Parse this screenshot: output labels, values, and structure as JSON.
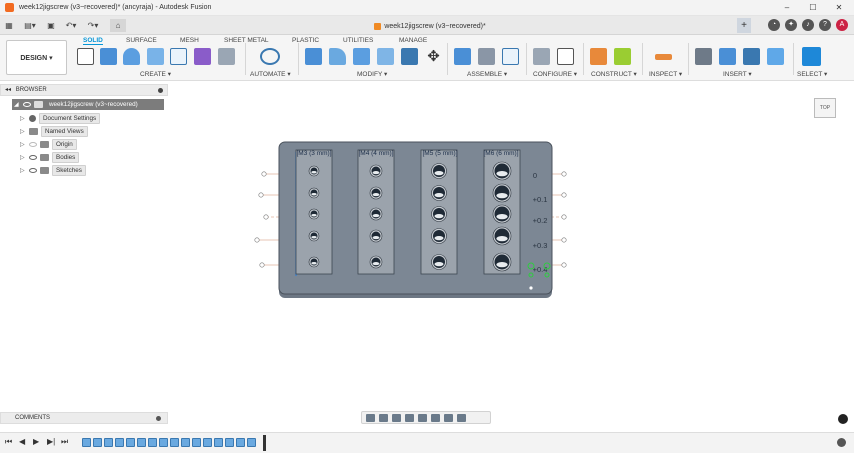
{
  "window": {
    "title": "week12jigscrew (v3~recovered)* (ancyraja) - Autodesk Fusion",
    "controls": [
      "–",
      "☐",
      "✕"
    ]
  },
  "tabstrip": {
    "document_tab": "week12jigscrew (v3~recovered)*"
  },
  "toolbar": {
    "workspace": "DESIGN ▾",
    "tabs": [
      "SOLID",
      "SURFACE",
      "MESH",
      "SHEET METAL",
      "PLASTIC",
      "UTILITIES",
      "MANAGE"
    ],
    "active_tab": "SOLID",
    "groups": [
      "CREATE ▾",
      "AUTOMATE ▾",
      "MODIFY ▾",
      "ASSEMBLE ▾",
      "CONFIGURE ▾",
      "CONSTRUCT ▾",
      "INSPECT ▾",
      "INSERT ▾",
      "SELECT ▾"
    ]
  },
  "browser": {
    "header": "BROWSER",
    "root": "week12jigscrew (v3~recovered)",
    "items": [
      "Document Settings",
      "Named Views",
      "Origin",
      "Bodies",
      "Sketches"
    ]
  },
  "viewcube": {
    "face": "TOP"
  },
  "model": {
    "column_labels": [
      "[M3 (3 mm)]",
      "[M4 (4 mm)]",
      "[M5 (5 mm)]",
      "[M6 (6 mm)]"
    ],
    "tolerance_labels": [
      "0",
      "+0.1",
      "+0.2",
      "+0.3",
      "+0.4"
    ]
  },
  "comments": {
    "label": "COMMENTS"
  },
  "colors": {
    "accent": "#0696d7",
    "plate": "#7c8794",
    "strip": "#9ba3ac"
  }
}
